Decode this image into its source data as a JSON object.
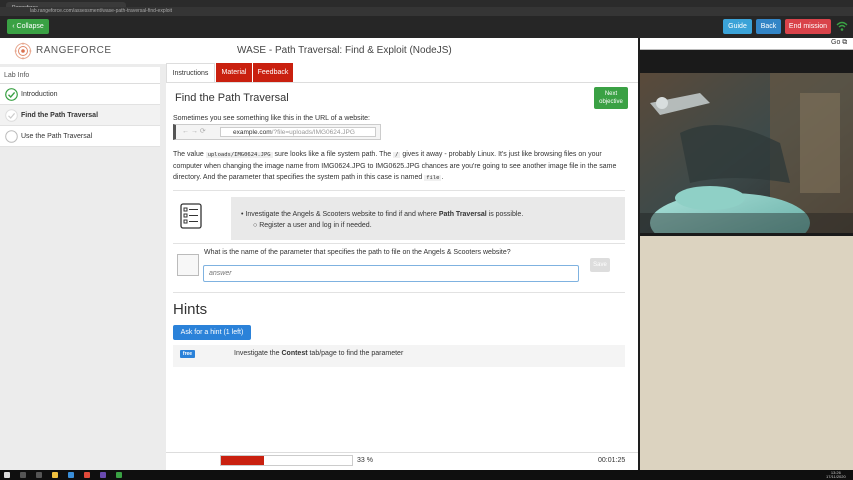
{
  "browser": {
    "tab_title": "Rangeforce",
    "url": "lab.rangeforce.com/assessment/wase-path-traversal-find-exploit"
  },
  "topbar": {
    "collapse_label": "‹ Collapse",
    "guide_label": "Guide",
    "back_label": "Back",
    "end_label": "End mission"
  },
  "header": {
    "brand": "RANGEFORCE",
    "title": "WASE - Path Traversal: Find & Exploit (NodeJS)"
  },
  "sidebar": {
    "heading": "Lab Info",
    "items": [
      {
        "label": "Introduction",
        "state": "done"
      },
      {
        "label": "Find the Path Traversal",
        "state": "active"
      },
      {
        "label": "Use the Path Traversal",
        "state": "todo"
      }
    ]
  },
  "tabs": {
    "instructions": "Instructions",
    "material": "Material",
    "feedback": "Feedback"
  },
  "content": {
    "heading": "Find the Path Traversal",
    "next_line1": "Next",
    "next_line2": "objective",
    "intro": "Sometimes you see something like this in the URL of a website:",
    "mini_url_domain": "example.com",
    "mini_url_path": "/?file=uploads/IMG0624.JPG",
    "para_1": "The value ",
    "para_code_1": "uploads/IMG0624.JPG",
    "para_2": " sure looks like a file system path. The ",
    "para_code_2": "/",
    "para_3": " gives it away - probably Linux. It's just like browsing files on your computer when changing the image name from IMG0624.JPG to IMG0625.JPG chances are you're going to see another image file in the same directory. And the parameter that specifies the system path in this case is named ",
    "para_code_3": "file",
    "para_4": "."
  },
  "task": {
    "line1_pre": "Investigate the Angels & Scooters website to find if and where ",
    "line1_bold": "Path Traversal",
    "line1_post": " is possible.",
    "line2": "Register a user and log in if needed."
  },
  "question": {
    "text": "What is the name of the parameter that specifies the path to file on the Angels & Scooters website?",
    "placeholder": "answer",
    "save_label": "Save"
  },
  "hints": {
    "title": "Hints",
    "ask_label": "Ask for a hint (1 left)",
    "badge": "free",
    "hint_pre": "Investigate the ",
    "hint_bold": "Contest",
    "hint_post": " tab/page to find the parameter"
  },
  "footer": {
    "progress_percent": 33,
    "progress_label": "33 %",
    "timer": "00:01:25"
  },
  "right_panel": {
    "go_label": "Go"
  },
  "taskbar": {
    "time": "13:26",
    "date": "17/11/2020"
  },
  "colors": {
    "accent_green": "#3aa144",
    "accent_red": "#c9200f",
    "accent_blue": "#2b82d9"
  }
}
